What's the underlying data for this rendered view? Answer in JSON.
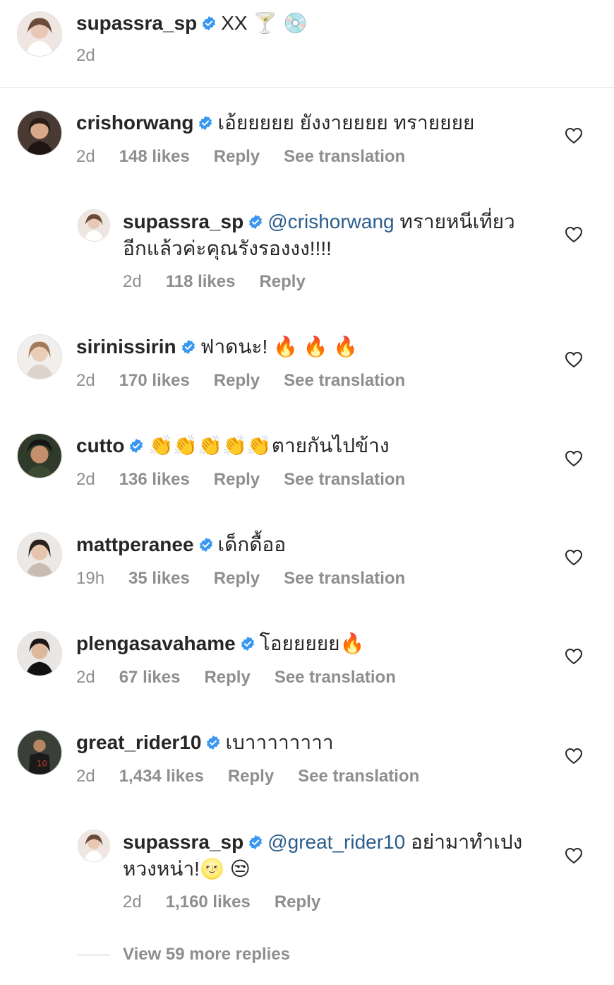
{
  "caption": {
    "username": "supassra_sp",
    "text": "XX",
    "emojis": [
      "🍸",
      "💿"
    ],
    "time": "2d"
  },
  "comments": [
    {
      "username": "crishorwang",
      "text": "เอ้ยยยยย ยังงายยยย ทรายยยย",
      "time": "2d",
      "likes": "148 likes",
      "reply": "Reply",
      "translate": "See translation"
    },
    {
      "username": "supassra_sp",
      "mention": "@crishorwang",
      "text": "ทรายหนีเที่ยว",
      "text2": "อีกแล้วค่ะคุณรังรองงง!!!!",
      "time": "2d",
      "likes": "118 likes",
      "reply": "Reply"
    },
    {
      "username": "sirinissirin",
      "text": "ฟาดนะ!",
      "emojis": "🔥 🔥 🔥",
      "time": "2d",
      "likes": "170 likes",
      "reply": "Reply",
      "translate": "See translation"
    },
    {
      "username": "cutto",
      "emojis": "👏👏👏👏👏",
      "text": "ตายกันไปข้าง",
      "time": "2d",
      "likes": "136 likes",
      "reply": "Reply",
      "translate": "See translation"
    },
    {
      "username": "mattperanee",
      "text": "เด็กดื้ออ",
      "time": "19h",
      "likes": "35 likes",
      "reply": "Reply",
      "translate": "See translation"
    },
    {
      "username": "plengasavahame",
      "text": "โอยยยยย",
      "emojis": "🔥",
      "time": "2d",
      "likes": "67 likes",
      "reply": "Reply",
      "translate": "See translation"
    },
    {
      "username": "great_rider10",
      "text": "เบาาาาาาาา",
      "time": "2d",
      "likes": "1,434 likes",
      "reply": "Reply",
      "translate": "See translation"
    },
    {
      "username": "supassra_sp",
      "mention": "@great_rider10",
      "text": "อย่ามาทำเปง",
      "text2": "หวงหน่า!",
      "emojis": "🌝 😒",
      "time": "2d",
      "likes": "1,160 likes",
      "reply": "Reply"
    }
  ],
  "view_more": "View 59 more replies",
  "colors": {
    "verified": "#3897f0",
    "mention": "#2b5d8c",
    "meta": "#8e8e8e",
    "text": "#262626"
  }
}
